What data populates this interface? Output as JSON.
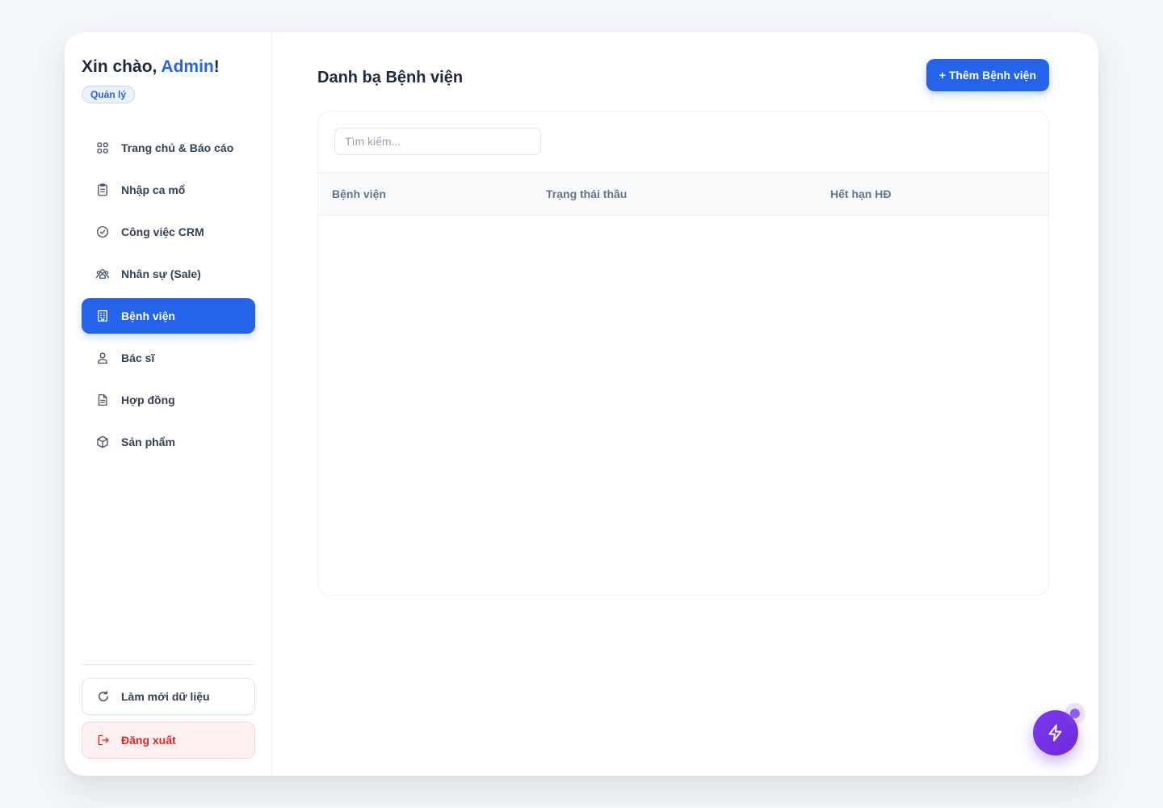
{
  "sidebar": {
    "greeting_prefix": "Xin chào, ",
    "user_name": "Admin",
    "greeting_suffix": "!",
    "role": "Quản lý",
    "items": [
      {
        "label": "Trang chủ & Báo cáo",
        "icon": "grid-icon"
      },
      {
        "label": "Nhập ca mổ",
        "icon": "clipboard-icon"
      },
      {
        "label": "Công việc CRM",
        "icon": "check-circle-icon"
      },
      {
        "label": "Nhân sự (Sale)",
        "icon": "users-icon"
      },
      {
        "label": "Bệnh viện",
        "icon": "building-icon",
        "active": true
      },
      {
        "label": "Bác sĩ",
        "icon": "user-icon"
      },
      {
        "label": "Hợp đồng",
        "icon": "document-icon"
      },
      {
        "label": "Sản phẩm",
        "icon": "box-icon"
      }
    ],
    "refresh_label": "Làm mới dữ liệu",
    "logout_label": "Đăng xuất"
  },
  "main": {
    "title": "Danh bạ Bệnh viện",
    "add_button": "+ Thêm Bệnh viện",
    "search": {
      "placeholder": "Tìm kiếm...",
      "value": ""
    },
    "table": {
      "columns": [
        "Bệnh viện",
        "Trạng thái thầu",
        "Hết hạn HĐ"
      ],
      "rows": []
    }
  },
  "fab": {
    "icon": "lightning-icon"
  },
  "colors": {
    "accent": "#2563eb",
    "fab": "#7c3aed",
    "danger": "#dc2626"
  }
}
